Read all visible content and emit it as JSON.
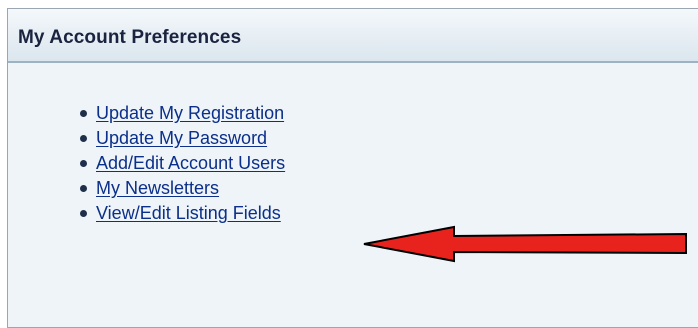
{
  "panel": {
    "title": "My Account Preferences"
  },
  "menu": {
    "items": [
      {
        "label": "Update My Registration"
      },
      {
        "label": "Update My Password"
      },
      {
        "label": "Add/Edit Account Users"
      },
      {
        "label": "My Newsletters"
      },
      {
        "label": "View/Edit Listing Fields"
      }
    ]
  },
  "annotation": {
    "arrow_color": "#e8231e",
    "arrow_outline": "#000000",
    "icon": "arrow-left-icon"
  },
  "colors": {
    "panel_bg": "#eef4f8",
    "link": "#0b2f8a",
    "title": "#1a2440"
  }
}
